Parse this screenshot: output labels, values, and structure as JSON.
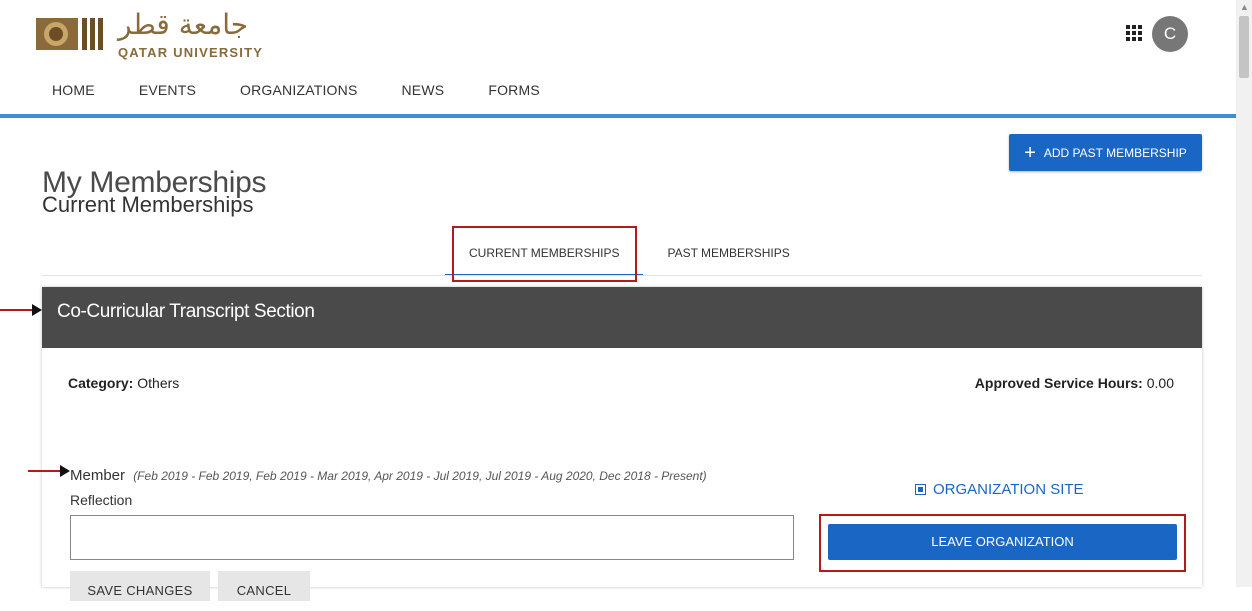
{
  "brand": {
    "arabic_name": "جامعة قطر",
    "english_name": "QATAR UNIVERSITY"
  },
  "user": {
    "avatar_initial": "C"
  },
  "nav": {
    "items": [
      {
        "label": "HOME",
        "active": true
      },
      {
        "label": "EVENTS",
        "active": false
      },
      {
        "label": "ORGANIZATIONS",
        "active": false
      },
      {
        "label": "NEWS",
        "active": false
      },
      {
        "label": "FORMS",
        "active": false
      }
    ]
  },
  "page": {
    "title": "My Memberships",
    "subtitle": "Current Memberships",
    "add_button_label": "ADD PAST MEMBERSHIP"
  },
  "tabs": [
    {
      "label": "CURRENT MEMBERSHIPS",
      "active": true
    },
    {
      "label": "PAST MEMBERSHIPS",
      "active": false
    }
  ],
  "card": {
    "header": "Co-Curricular Transcript Section",
    "category_label": "Category:",
    "category_value": "Others",
    "hours_label": "Approved Service Hours:",
    "hours_value": "0.00",
    "member_role": "Member",
    "member_dates": "(Feb 2019 - Feb 2019, Feb 2019 - Mar 2019, Apr 2019 - Jul 2019, Jul 2019 - Aug 2020, Dec 2018 - Present)",
    "reflection_label": "Reflection",
    "reflection_value": "",
    "save_label": "SAVE CHANGES",
    "cancel_label": "CANCEL",
    "org_site_label": "ORGANIZATION SITE",
    "leave_label": "LEAVE ORGANIZATION"
  },
  "colors": {
    "accent": "#1a66c4",
    "nav_rule": "#3a8fd8",
    "card_header": "#4a4a4a",
    "annotation": "#b31b1b"
  }
}
